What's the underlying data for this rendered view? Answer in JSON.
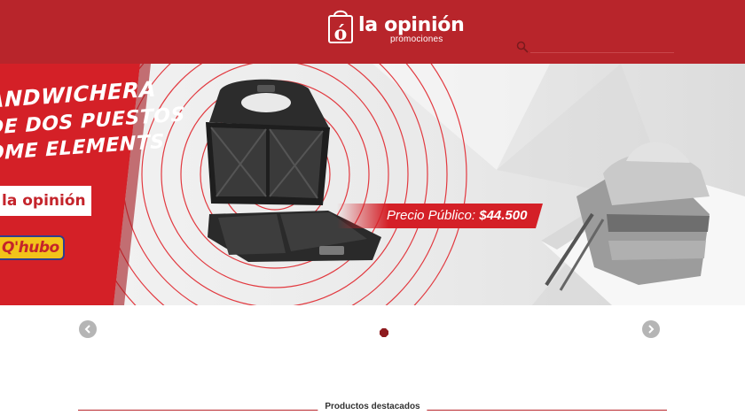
{
  "colors": {
    "brand_red": "#b8252b",
    "promo_red": "#d42027",
    "white": "#ffffff",
    "nav_gray": "#b5b5b5",
    "dot_red": "#8e1b1f"
  },
  "header": {
    "logo": {
      "name": "la opinión",
      "sub": "promociones",
      "icon": "shopping-bag-icon"
    },
    "search": {
      "icon": "search-icon",
      "placeholder": ""
    }
  },
  "banner": {
    "headline": [
      "ANDWICHERA",
      "DE DOS PUESTOS",
      "OME ELEMENTS"
    ],
    "brand": "la opinión",
    "partner": "Q'hubo",
    "price_label": "Precio Público:",
    "price_value": "$44.500",
    "product_image": "sandwich-maker",
    "decor_image": "sandwich-plate"
  },
  "carousel": {
    "prev_icon": "chevron-left-icon",
    "next_icon": "chevron-right-icon",
    "slide_count": 1,
    "active_slide": 1
  },
  "featured": {
    "title": "Productos destacados"
  }
}
